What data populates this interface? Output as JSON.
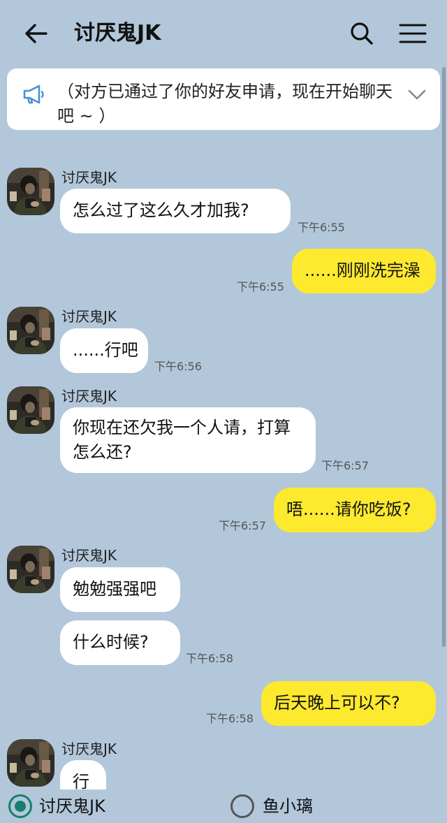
{
  "header": {
    "title": "讨厌鬼JK",
    "back_icon": "arrow-left-icon",
    "search_icon": "search-icon",
    "menu_icon": "menu-icon"
  },
  "notice": {
    "icon": "megaphone-icon",
    "text": "（对方已通过了你的好友申请，现在开始聊天吧 ~ ）",
    "chevron_icon": "chevron-down-icon"
  },
  "messages": [
    {
      "direction": "in",
      "sender": "讨厌鬼JK",
      "text": "怎么过了这么久才加我?",
      "time": "下午6:55"
    },
    {
      "direction": "out",
      "text": "......刚刚洗完澡",
      "time": "下午6:55"
    },
    {
      "direction": "in",
      "sender": "讨厌鬼JK",
      "text": "......行吧",
      "time": "下午6:56"
    },
    {
      "direction": "in",
      "sender": "讨厌鬼JK",
      "text": "你现在还欠我一个人请，打算怎么还?",
      "time": "下午6:57"
    },
    {
      "direction": "out",
      "text": "唔......请你吃饭?",
      "time": "下午6:57"
    },
    {
      "direction": "in",
      "sender": "讨厌鬼JK",
      "text": "勉勉强强吧"
    },
    {
      "direction": "in",
      "text": "什么时候?",
      "time": "下午6:58"
    },
    {
      "direction": "out",
      "text": "后天晚上可以不?",
      "time": "下午6:58"
    },
    {
      "direction": "in",
      "sender": "讨厌鬼JK",
      "text": "行"
    }
  ],
  "speaker_select": {
    "options": [
      {
        "label": "讨厌鬼JK",
        "selected": true
      },
      {
        "label": "鱼小璃",
        "selected": false
      }
    ]
  },
  "colors": {
    "background": "#b2c7da",
    "incoming_bubble": "#ffffff",
    "outgoing_bubble": "#fde92e",
    "radio_selected": "#17806d"
  }
}
